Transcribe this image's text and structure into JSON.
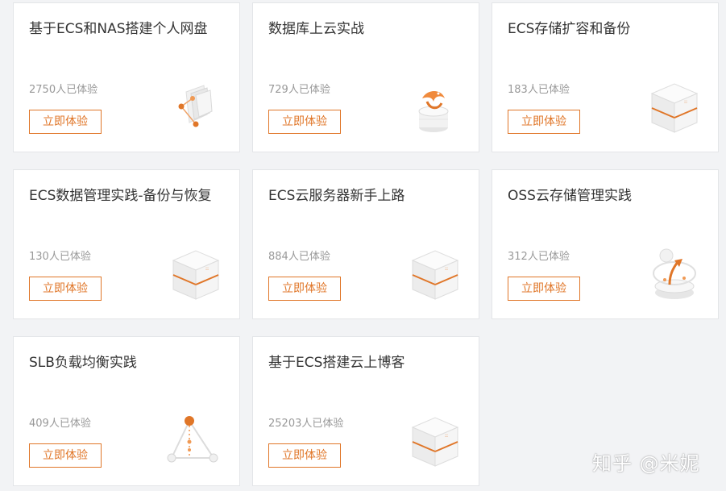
{
  "cards": [
    {
      "title": "基于ECS和NAS搭建个人网盘",
      "count": "2750人已体验",
      "button": "立即体验",
      "icon": "storage-network-icon"
    },
    {
      "title": "数据库上云实战",
      "count": "729人已体验",
      "button": "立即体验",
      "icon": "database-dolphin-icon"
    },
    {
      "title": "ECS存储扩容和备份",
      "count": "183人已体验",
      "button": "立即体验",
      "icon": "server-cube-icon"
    },
    {
      "title": "ECS数据管理实践-备份与恢复",
      "count": "130人已体验",
      "button": "立即体验",
      "icon": "server-cube-icon"
    },
    {
      "title": "ECS云服务器新手上路",
      "count": "884人已体验",
      "button": "立即体验",
      "icon": "server-cube-icon"
    },
    {
      "title": "OSS云存储管理实践",
      "count": "312人已体验",
      "button": "立即体验",
      "icon": "cloud-upload-icon"
    },
    {
      "title": "SLB负载均衡实践",
      "count": "409人已体验",
      "button": "立即体验",
      "icon": "load-balancer-icon"
    },
    {
      "title": "基于ECS搭建云上博客",
      "count": "25203人已体验",
      "button": "立即体验",
      "icon": "server-cube-icon"
    }
  ],
  "watermark": "知乎 @米妮",
  "colors": {
    "accent": "#e07628",
    "title": "#333333",
    "count": "#999999",
    "card_border": "#e3e5e8",
    "page_bg": "#f2f3f5"
  }
}
